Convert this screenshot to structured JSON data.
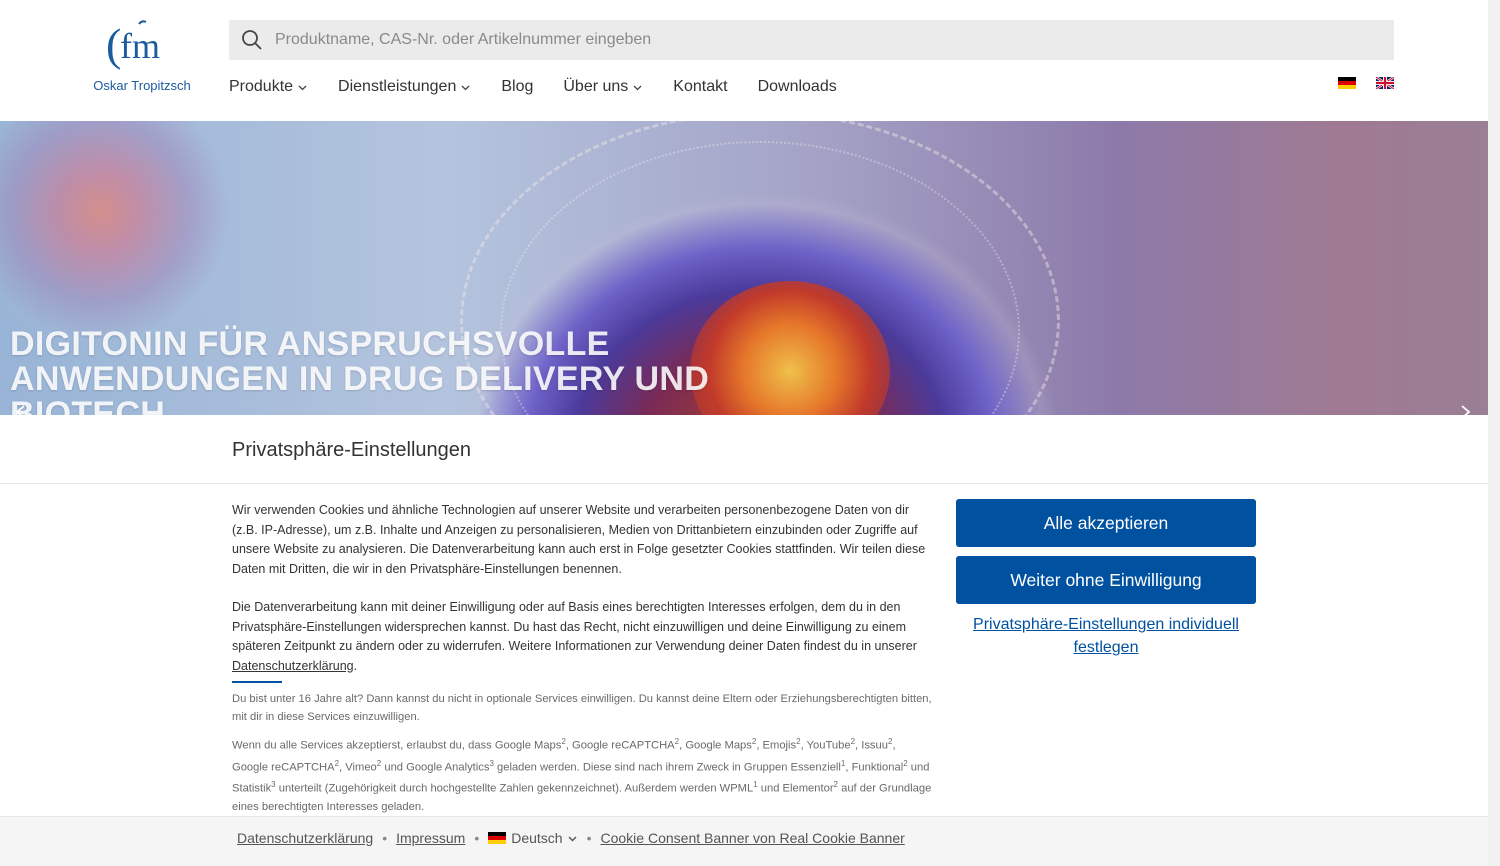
{
  "header": {
    "logo_text": "Oskar Tropitzsch",
    "search_placeholder": "Produktname, CAS-Nr. oder Artikelnummer eingeben",
    "nav": [
      {
        "label": "Produkte",
        "has_dropdown": true
      },
      {
        "label": "Dienstleistungen",
        "has_dropdown": true
      },
      {
        "label": "Blog",
        "has_dropdown": false
      },
      {
        "label": "Über uns",
        "has_dropdown": true
      },
      {
        "label": "Kontakt",
        "has_dropdown": false
      },
      {
        "label": "Downloads",
        "has_dropdown": false
      }
    ],
    "languages": [
      "de-flag-icon",
      "uk-flag-icon"
    ]
  },
  "hero": {
    "title": "DIGITONIN FÜR ANSPRUCHSVOLLE ANWEN­DUNGEN IN DRUG DELIVERY UND BIOTECH"
  },
  "cookie": {
    "title": "Privatsphäre-Einstellungen",
    "para1": "Wir verwenden Cookies und ähnliche Technologien auf unserer Website und verarbeiten personenbezogene Daten von dir (z.B. IP-Adresse), um z.B. Inhalte und Anzeigen zu personalisieren, Medien von Drittanbietern einzubinden oder Zugriffe auf unsere Website zu analysieren. Die Datenverarbeitung kann auch erst in Folge gesetzter Cookies stattfinden. Wir teilen diese Daten mit Dritten, die wir in den Privatsphäre-Einstellungen benennen.",
    "para2": "Die Datenverarbeitung kann mit deiner Einwilligung oder auf Basis eines berechtigten Interesses erfolgen, dem du in den Privatsphäre-Einstellungen widersprechen kannst. Du hast das Recht, nicht einzuwilligen und deine Einwilligung zu einem späteren Zeitpunkt zu ändern oder zu widerrufen. Weitere Informationen zur Verwendung deiner Daten findest du in unse­rer ",
    "privacy_link": "Datenschutzerklärung",
    "para2_end": ".",
    "age_note": "Du bist unter 16 Jahre alt? Dann kannst du nicht in optionale Services einwilligen. Du kannst deine Eltern oder Erziehungsberechtig­ten bitten, mit dir in diese Services einzuwilligen.",
    "services_note": [
      {
        "t": "Wenn du alle Services akzeptierst, erlaubst du, dass Google Maps",
        "s": "2"
      },
      {
        "t": ", Google reCAPTCHA",
        "s": "2"
      },
      {
        "t": ", Google Maps",
        "s": "2"
      },
      {
        "t": ", Emojis",
        "s": "2"
      },
      {
        "t": ", YouTube",
        "s": "2"
      },
      {
        "t": ", Issuu",
        "s": "2"
      },
      {
        "t": ", Google reCAPTCHA",
        "s": "2"
      },
      {
        "t": ", Vimeo",
        "s": "2"
      },
      {
        "t": " und Google Analytics",
        "s": "3"
      },
      {
        "t": " geladen werden. Diese sind nach ihrem Zweck in Gruppen Essenziell",
        "s": "1"
      },
      {
        "t": ", Funktio­nal",
        "s": "2"
      },
      {
        "t": " und Statistik",
        "s": "3"
      },
      {
        "t": " unterteilt (Zugehörigkeit durch hochgestellte Zahlen gekennzeichnet). Außerdem werden WPML",
        "s": "1"
      },
      {
        "t": " und Elementor",
        "s": "2"
      },
      {
        "t": " auf der Grundlage eines berechtigten Interesses geladen.",
        "s": ""
      }
    ],
    "btn_accept": "Alle akzeptieren",
    "btn_continue": "Weiter ohne Einwilligung",
    "link_individual": "Privatsphäre-Einstellungen individuell festlegen"
  },
  "footer": {
    "privacy": "Datenschutzerklärung",
    "imprint": "Impressum",
    "language": "Deutsch",
    "banner_credit": "Cookie Consent Banner von Real Cookie Banner"
  },
  "colors": {
    "accent": "#0051a0",
    "logo_blue": "#1b5b9e"
  }
}
